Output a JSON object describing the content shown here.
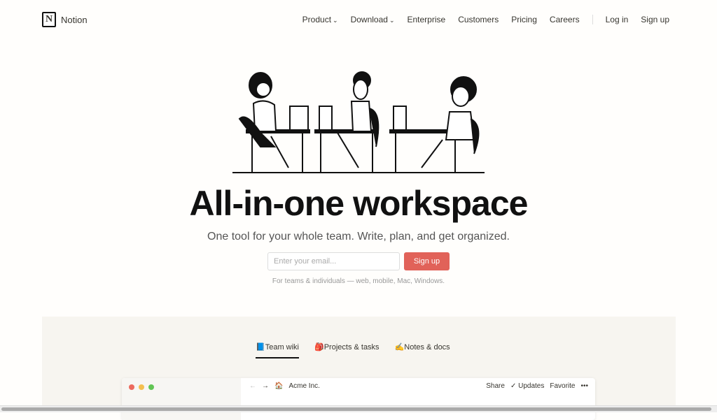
{
  "nav": {
    "brand": "Notion",
    "logo_letter": "N",
    "links": [
      "Product",
      "Download",
      "Enterprise",
      "Customers",
      "Pricing",
      "Careers"
    ],
    "login": "Log in",
    "signup": "Sign up"
  },
  "hero": {
    "title": "All-in-one workspace",
    "subtitle": "One tool for your whole team. Write, plan, and get organized.",
    "email_placeholder": "Enter your email...",
    "signup_button": "Sign up",
    "note": "For teams & individuals — web, mobile, Mac, Windows."
  },
  "tabs": [
    {
      "emoji": "📘",
      "label": "Team wiki",
      "active": true
    },
    {
      "emoji": "🎒",
      "label": "Projects & tasks"
    },
    {
      "emoji": "✍️",
      "label": "Notes & docs"
    }
  ],
  "window": {
    "page_emoji": "🏠",
    "page_title": "Acme Inc.",
    "share": "Share",
    "updates": "Updates",
    "favorite": "Favorite",
    "more": "•••"
  },
  "colors": {
    "accent": "#e16259",
    "dot_red": "#ec6a5e",
    "dot_yellow": "#f4bf4f",
    "dot_green": "#61c554"
  }
}
